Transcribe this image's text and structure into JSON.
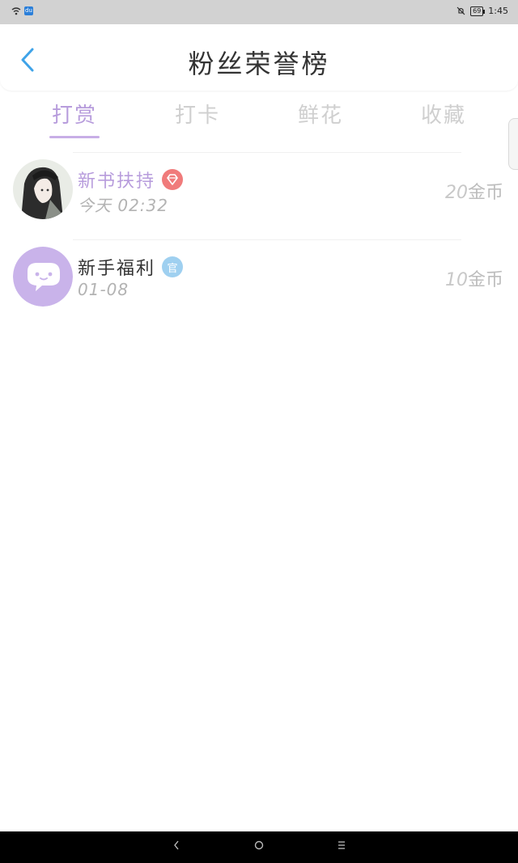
{
  "status_bar": {
    "time": "1:45",
    "battery": "69",
    "app_icon_label": "du"
  },
  "header": {
    "title": "粉丝荣誉榜",
    "back_icon": "chevron-left-icon"
  },
  "tabs": [
    {
      "label": "打赏",
      "active": true
    },
    {
      "label": "打卡",
      "active": false
    },
    {
      "label": "鲜花",
      "active": false
    },
    {
      "label": "收藏",
      "active": false
    }
  ],
  "list": [
    {
      "name": "新书扶持",
      "badge": "diamond-icon",
      "time": "今天 02:32",
      "amount_value": "20",
      "amount_unit": "金币"
    },
    {
      "name": "新手福利",
      "badge_label": "官",
      "badge": "official-icon",
      "time": "01-08",
      "amount_value": "10",
      "amount_unit": "金币"
    }
  ],
  "colors": {
    "accent": "#b79cdc",
    "back": "#3fa3e8",
    "diamond_badge": "#f07b7b",
    "official_badge": "#9fd0f0"
  }
}
